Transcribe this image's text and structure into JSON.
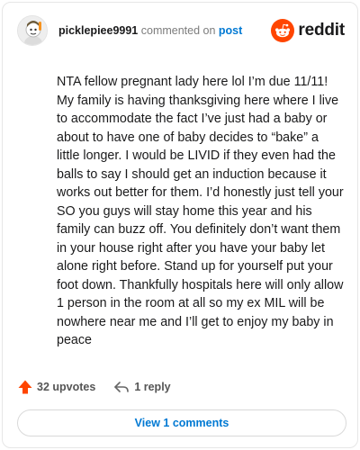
{
  "header": {
    "username": "picklepiee9991",
    "action_text": " commented on ",
    "post_link": "post",
    "brand_name": "reddit",
    "brand_icon": "reddit-snoo-icon",
    "avatar_icon": "user-avatar"
  },
  "comment": {
    "text": "NTA fellow pregnant lady here lol I’m due 11/11! My family is having thanksgiving here where I live to accommodate the fact I’ve just had a baby or about to have one of baby decides to “bake” a little longer. I would be LIVID if they even had the balls to say I should get an induction because it works out better for them. I’d honestly just tell your SO you guys will stay home this year and his family can buzz off. You definitely don’t want them in your house right after you have your baby let alone right before. Stand up for yourself put your foot down. Thankfully hospitals here will only allow 1 person in the room at all so my ex MIL will be nowhere near me and I’ll get to enjoy my baby in peace"
  },
  "footer": {
    "upvotes_label": "32 upvotes",
    "reply_label": "1 reply",
    "view_comments_label": "View 1 comments"
  },
  "colors": {
    "brand_orange": "#ff4500",
    "link_blue": "#0079d3",
    "text": "#1a1a1b",
    "muted": "#7c7c7c",
    "upvote_orange": "#ff4500"
  }
}
